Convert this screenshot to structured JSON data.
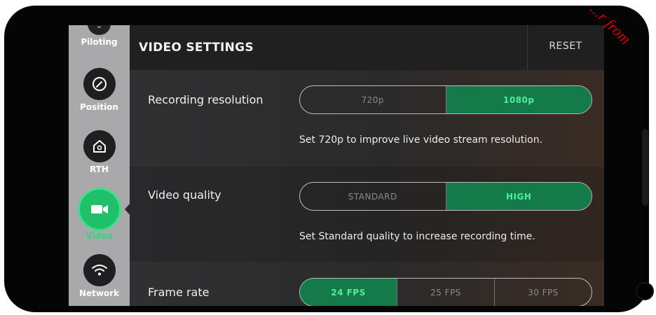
{
  "watermark": "...r from",
  "sidebar": {
    "items": [
      {
        "label": "Piloting",
        "icon": "chevron-down-icon"
      },
      {
        "label": "Position",
        "icon": "gauge-icon"
      },
      {
        "label": "RTH",
        "icon": "home-icon"
      },
      {
        "label": "Video",
        "icon": "video-camera-icon",
        "active": true
      },
      {
        "label": "Network",
        "icon": "wifi-icon"
      }
    ]
  },
  "header": {
    "title": "VIDEO SETTINGS",
    "reset_label": "RESET"
  },
  "settings": {
    "resolution": {
      "label": "Recording resolution",
      "options": [
        "720p",
        "1080p"
      ],
      "selected": "1080p",
      "hint": "Set 720p to improve live video stream resolution."
    },
    "quality": {
      "label": "Video quality",
      "options": [
        "STANDARD",
        "HIGH"
      ],
      "selected": "HIGH",
      "hint": "Set Standard quality to increase recording time."
    },
    "framerate": {
      "label": "Frame rate",
      "options": [
        "24 FPS",
        "25 FPS",
        "30 FPS"
      ],
      "selected": "24 FPS"
    }
  },
  "colors": {
    "accent": "#20c06a",
    "accent_text": "#4cf09a",
    "selected_segment": "#157a4a",
    "sidebar_bg": "#a9a9ab",
    "header_bg": "#202021"
  }
}
